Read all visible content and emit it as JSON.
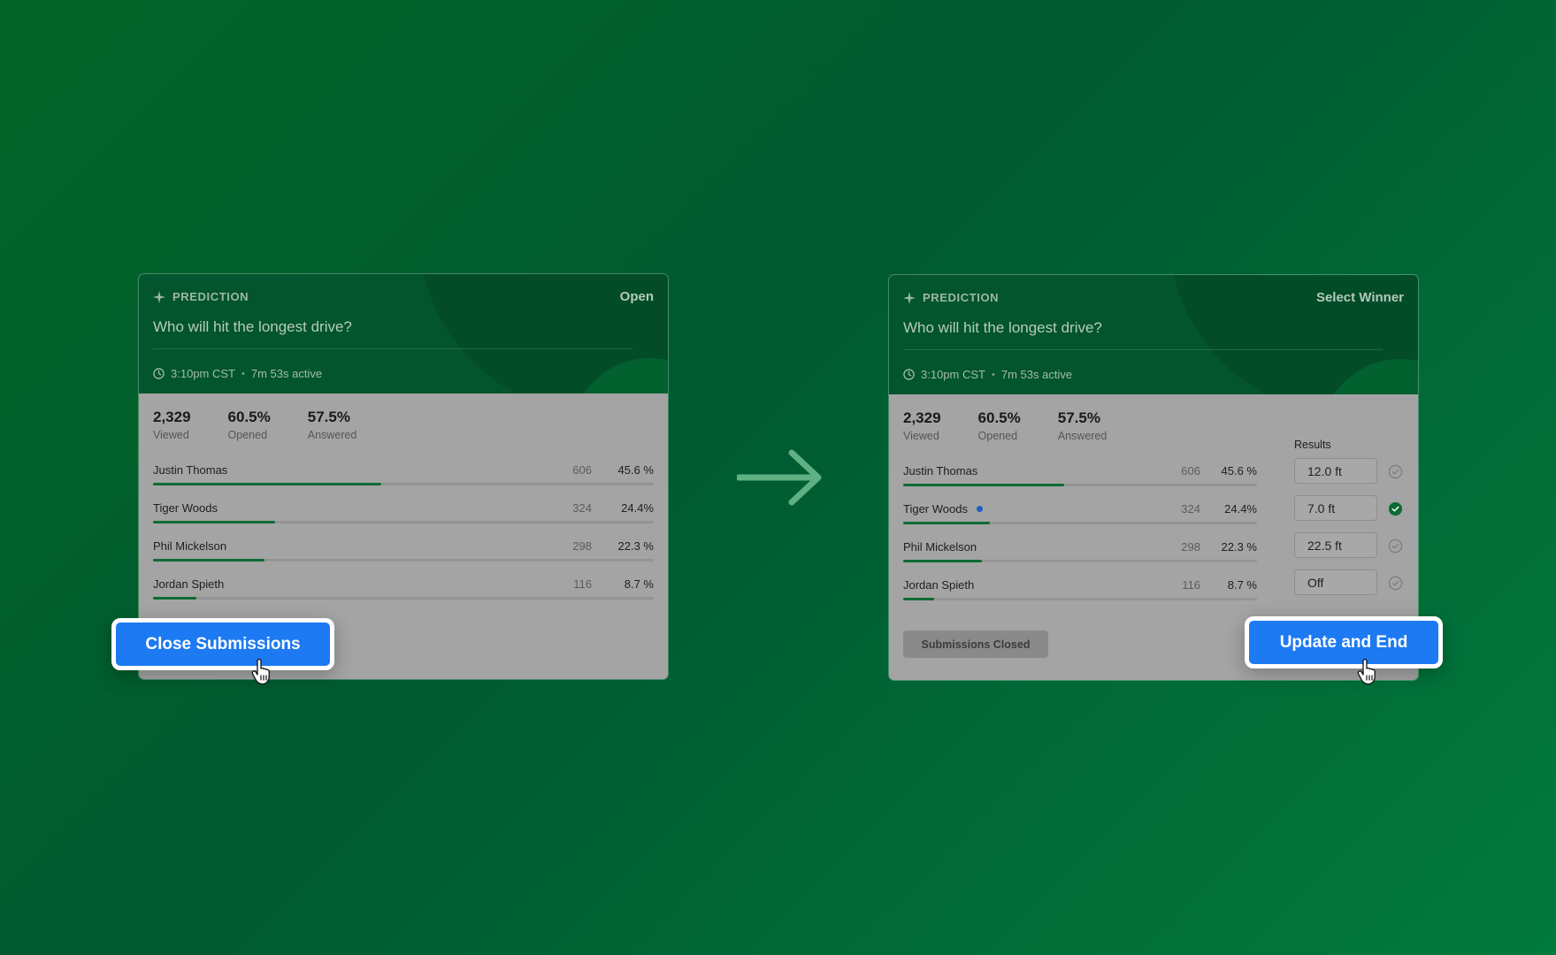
{
  "colors": {
    "background_start": "#036628",
    "background_end": "#027a3c",
    "card_header": "#02552d",
    "card_body": "#a4a4a4",
    "bar_fill": "#0d6b36",
    "cta_blue": "#1d7af2",
    "winner_dot": "#1b5fc7"
  },
  "icons": [
    "sparkle-icon",
    "clock-icon",
    "check-circle-icon",
    "pointer-hand-icon",
    "arrow-right-icon"
  ],
  "left_card": {
    "kind": "PREDICTION",
    "status": "Open",
    "question": "Who will hit the longest drive?",
    "time": "3:10pm CST",
    "separator": "•",
    "active": "7m 53s active",
    "stats": [
      {
        "value": "2,329",
        "label": "Viewed"
      },
      {
        "value": "60.5%",
        "label": "Opened"
      },
      {
        "value": "57.5%",
        "label": "Answered"
      }
    ],
    "options": [
      {
        "name": "Justin Thomas",
        "count": "606",
        "percent": "45.6 %",
        "share": 0.456
      },
      {
        "name": "Tiger Woods",
        "count": "324",
        "percent": "24.4%",
        "share": 0.244
      },
      {
        "name": "Phil Mickelson",
        "count": "298",
        "percent": "22.3 %",
        "share": 0.223
      },
      {
        "name": "Jordan Spieth",
        "count": "116",
        "percent": "8.7 %",
        "share": 0.087
      }
    ],
    "cta_label": "Close Submissions"
  },
  "right_card": {
    "kind": "PREDICTION",
    "status": "Select Winner",
    "question": "Who will hit the longest drive?",
    "time": "3:10pm CST",
    "separator": "•",
    "active": "7m 53s active",
    "stats": [
      {
        "value": "2,329",
        "label": "Viewed"
      },
      {
        "value": "60.5%",
        "label": "Opened"
      },
      {
        "value": "57.5%",
        "label": "Answered"
      }
    ],
    "options": [
      {
        "name": "Justin Thomas",
        "count": "606",
        "percent": "45.6 %",
        "share": 0.456,
        "winner": false
      },
      {
        "name": "Tiger Woods",
        "count": "324",
        "percent": "24.4%",
        "share": 0.244,
        "winner": true
      },
      {
        "name": "Phil Mickelson",
        "count": "298",
        "percent": "22.3 %",
        "share": 0.223,
        "winner": false
      },
      {
        "name": "Jordan Spieth",
        "count": "116",
        "percent": "8.7 %",
        "share": 0.087,
        "winner": false
      }
    ],
    "results_label": "Results",
    "results": [
      {
        "value": "12.0 ft",
        "selected": false
      },
      {
        "value": "7.0 ft",
        "selected": true
      },
      {
        "value": "22.5 ft",
        "selected": false
      },
      {
        "value": "Off",
        "selected": false
      }
    ],
    "closed_label": "Submissions Closed",
    "cta_label": "Update and End"
  }
}
